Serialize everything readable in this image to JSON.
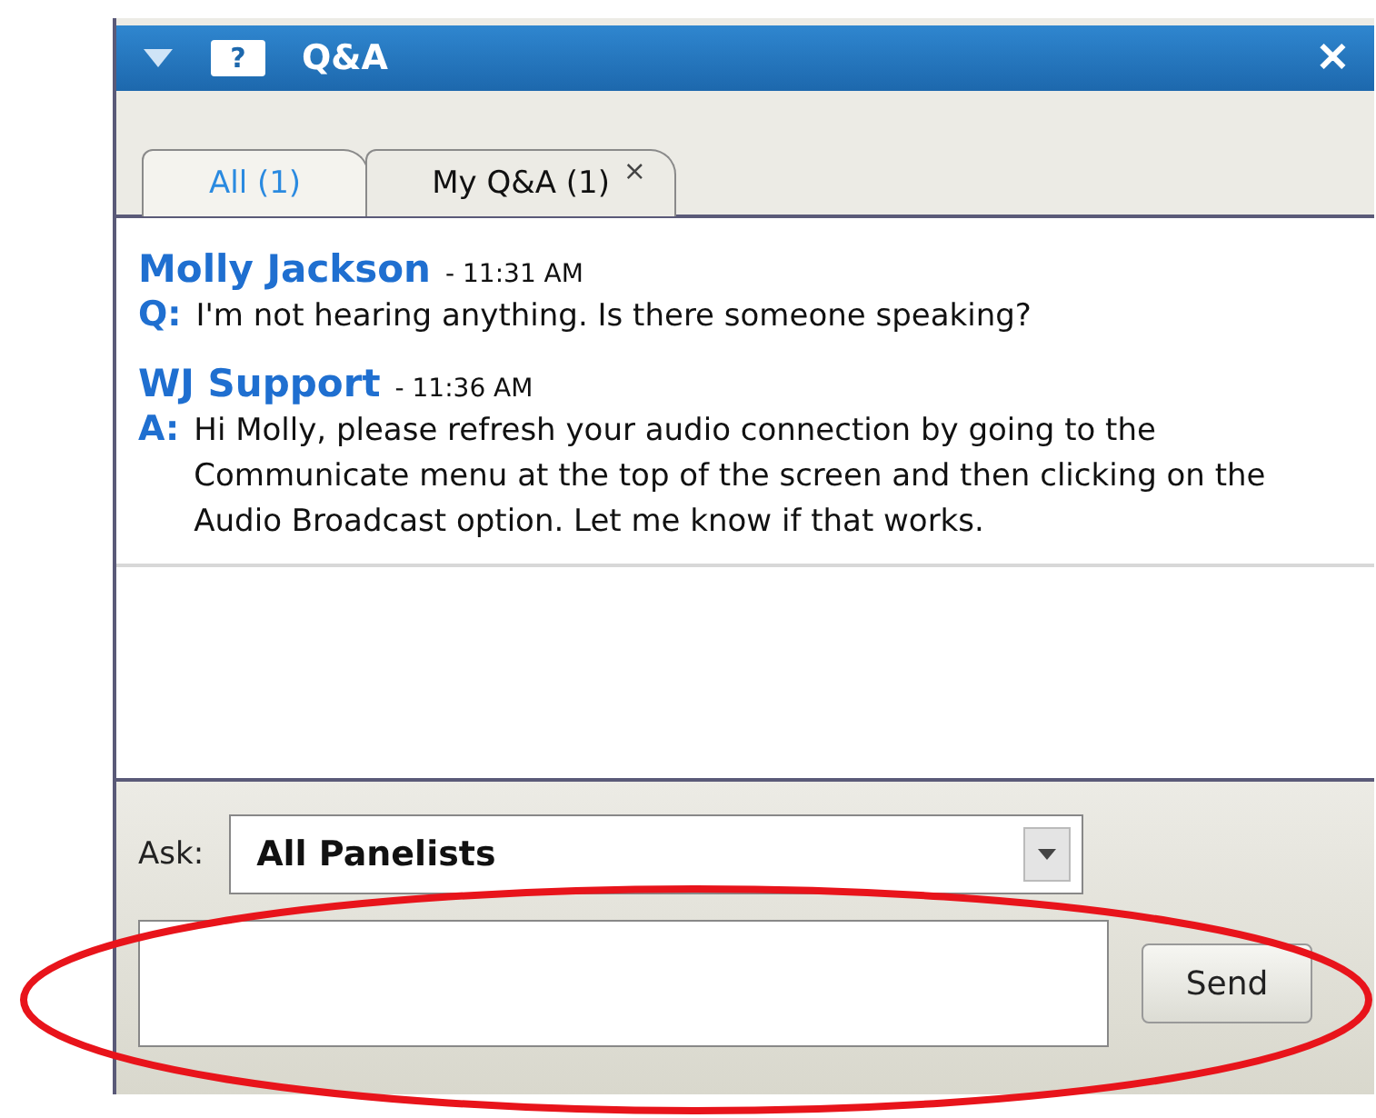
{
  "panel": {
    "title": "Q&A",
    "help_glyph": "?",
    "close_glyph": "✕"
  },
  "tabs": [
    {
      "label": "All (1)",
      "selected": true,
      "closable": false
    },
    {
      "label": "My Q&A (1)",
      "selected": false,
      "closable": true,
      "close_glyph": "×"
    }
  ],
  "messages": [
    {
      "author": "Molly Jackson",
      "time": "- 11:31 AM",
      "prefix": "Q:",
      "text": "I'm not hearing anything. Is there someone speaking?"
    },
    {
      "author": "WJ Support",
      "time": "- 11:36 AM",
      "prefix": "A:",
      "text": "Hi Molly, please refresh your audio connection by going to the Communicate menu at the top of the screen and then clicking on the Audio Broadcast option. Let me know if that works."
    }
  ],
  "ask": {
    "label": "Ask:",
    "value": "All Panelists"
  },
  "send_button": "Send",
  "annotation": {
    "highlight": true
  }
}
